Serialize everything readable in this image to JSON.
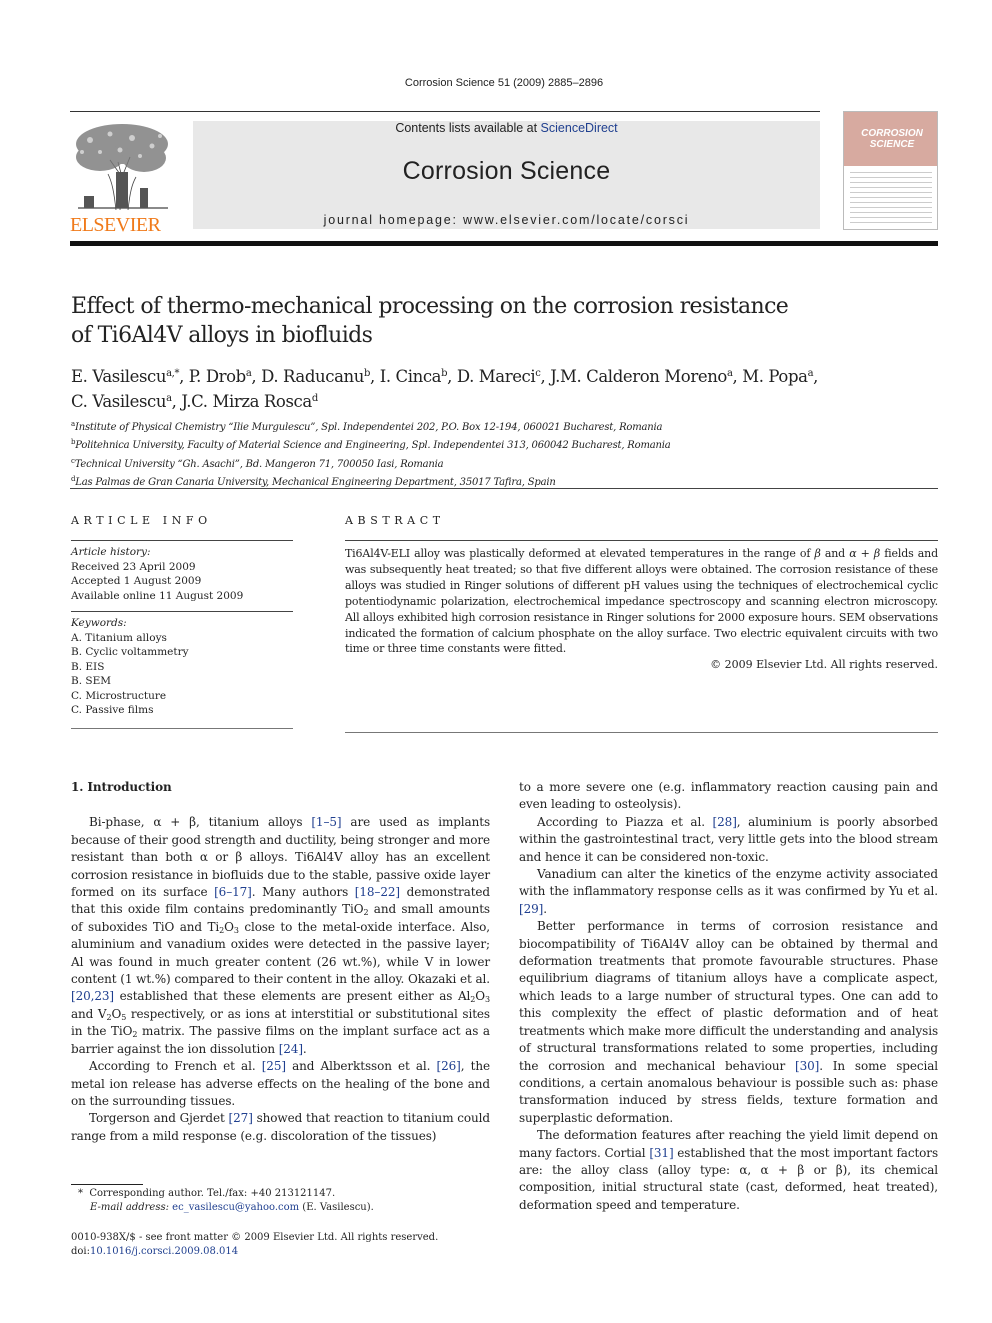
{
  "header": {
    "citation": "Corrosion Science 51 (2009) 2885–2896",
    "contents_prefix": "Contents lists available at ",
    "contents_link": "ScienceDirect",
    "journal_name": "Corrosion Science",
    "homepage": "journal homepage: www.elsevier.com/locate/corsci",
    "publisher_logo_text": "ELSEVIER",
    "cover_title_line1": "CORROSION",
    "cover_title_line2": "SCIENCE",
    "colors": {
      "publisher_orange": "#f07a1a",
      "link_blue": "#1f3f8f",
      "cover_pink": "#d7aaa0",
      "banner_gray": "#e8e8e8"
    }
  },
  "article": {
    "title_line1": "Effect of thermo-mechanical processing on the corrosion resistance",
    "title_line2": "of Ti6Al4V alloys in biofluids",
    "authors": [
      {
        "name": "E. Vasilescu",
        "aff": "a,*"
      },
      {
        "name": "P. Drob",
        "aff": "a"
      },
      {
        "name": "D. Raducanu",
        "aff": "b"
      },
      {
        "name": "I. Cinca",
        "aff": "b"
      },
      {
        "name": "D. Mareci",
        "aff": "c"
      },
      {
        "name": "J.M. Calderon Moreno",
        "aff": "a"
      },
      {
        "name": "M. Popa",
        "aff": "a"
      },
      {
        "name": "C. Vasilescu",
        "aff": "a"
      },
      {
        "name": "J.C. Mirza Rosca",
        "aff": "d"
      }
    ],
    "affiliations": [
      {
        "mark": "a",
        "text": "Institute of Physical Chemistry “Ilie Murgulescu”, Spl. Independentei 202, P.O. Box 12-194, 060021 Bucharest, Romania"
      },
      {
        "mark": "b",
        "text": "Politehnica University, Faculty of Material Science and Engineering, Spl. Independentei 313, 060042 Bucharest, Romania"
      },
      {
        "mark": "c",
        "text": "Technical University “Gh. Asachi”, Bd. Mangeron 71, 700050 Iasi, Romania"
      },
      {
        "mark": "d",
        "text": "Las Palmas de Gran Canaria University, Mechanical Engineering Department, 35017 Tafira, Spain"
      }
    ]
  },
  "article_info": {
    "heading": "ARTICLE INFO",
    "history_label": "Article history:",
    "received": "Received 23 April 2009",
    "accepted": "Accepted 1 August 2009",
    "online": "Available online 11 August 2009",
    "keywords_label": "Keywords:",
    "keywords": [
      "A. Titanium alloys",
      "B. Cyclic voltammetry",
      "B. EIS",
      "B. SEM",
      "C. Microstructure",
      "C. Passive films"
    ]
  },
  "abstract": {
    "heading": "ABSTRACT",
    "p1": "Ti6Al4V-ELI alloy was plastically deformed at elevated temperatures in the range of ",
    "beta": "β",
    "p2": " and ",
    "alpha_beta": "α + β",
    "p3": " fields and was subsequently heat treated; so that five different alloys were obtained. The corrosion resistance of these alloys was studied in Ringer solutions of different pH values using the techniques of electrochemical cyclic potentiodynamic polarization, electrochemical impedance spectroscopy and scanning electron microscopy. All alloys exhibited high corrosion resistance in Ringer solutions for 2000 exposure hours. SEM observations indicated the formation of calcium phosphate on the alloy surface. Two electric equivalent circuits with two time or three time constants were fitted.",
    "copyright": "© 2009 Elsevier Ltd. All rights reserved."
  },
  "body": {
    "section_heading": "1. Introduction",
    "left": {
      "p1_a": "Bi-phase, α + β, titanium alloys ",
      "ref_1_5": "[1–5]",
      "p1_b": " are used as implants because of their good strength and ductility, being stronger and more resistant than both α or β alloys. Ti6Al4V alloy has an excellent corrosion resistance in biofluids due to the stable, passive oxide layer formed on its surface ",
      "ref_6_17": "[6–17]",
      "p1_c": ". Many authors ",
      "ref_18_22": "[18–22]",
      "p1_d": " demonstrated that this oxide film contains predominantly TiO",
      "p1_e": " and small amounts of suboxides TiO and Ti",
      "p1_f": "O",
      "p1_g": " close to the metal-oxide interface. Also, aluminium and vanadium oxides were detected in the passive layer; Al was found in much greater content (26 wt.%), while V in lower content (1 wt.%) compared to their content in the alloy. Okazaki et al. ",
      "ref_20_23": "[20,23]",
      "p1_h": " established that these elements are present either as Al",
      "p1_i": "O",
      "p1_j": " and V",
      "p1_k": "O",
      "p1_l": " respectively, or as ions at interstitial or substitutional sites in the TiO",
      "p1_m": " matrix. The passive films on the implant surface act as a barrier against the ion dissolution ",
      "ref_24": "[24]",
      "p1_n": ".",
      "p2_a": "According to French et al. ",
      "ref_25": "[25]",
      "p2_b": " and Alberktsson et al. ",
      "ref_26": "[26]",
      "p2_c": ", the metal ion release has adverse effects on the healing of the bone and on the surrounding tissues.",
      "p3_a": "Torgerson and Gjerdet ",
      "ref_27": "[27]",
      "p3_b": " showed that reaction to titanium could range from a mild response (e.g. discoloration of the tissues)",
      "sub_2": "2",
      "sub_3": "3",
      "sub_5": "5"
    },
    "right": {
      "p0": "to a more severe one (e.g. inflammatory reaction causing pain and even leading to osteolysis).",
      "p1_a": "According to Piazza et al. ",
      "ref_28": "[28]",
      "p1_b": ", aluminium is poorly absorbed within the gastrointestinal tract, very little gets into the blood stream and hence it can be considered non-toxic.",
      "p2_a": "Vanadium can alter the kinetics of the enzyme activity associated with the inflammatory response cells as it was confirmed by Yu et al. ",
      "ref_29": "[29]",
      "p2_b": ".",
      "p3_a": "Better performance in terms of corrosion resistance and biocompatibility of Ti6Al4V alloy can be obtained by thermal and deformation treatments that promote favourable structures. Phase equilibrium diagrams of titanium alloys have a complicate aspect, which leads to a large number of structural types. One can add to this complexity the effect of plastic deformation and of heat treatments which make more difficult the understanding and analysis of structural transformations related to some properties, including the corrosion and mechanical behaviour ",
      "ref_30": "[30]",
      "p3_b": ". In some special conditions, a certain anomalous behaviour is possible such as: phase transformation induced by stress fields, texture formation and superplastic deformation.",
      "p4_a": "The deformation features after reaching the yield limit depend on many factors. Cortial ",
      "ref_31": "[31]",
      "p4_b": " established that the most important factors are: the alloy class (alloy type: α, α + β or β), its chemical composition, initial structural state (cast, deformed, heat treated), deformation speed and temperature."
    }
  },
  "footnote": {
    "mark": "*",
    "corresponding": "Corresponding author. Tel./fax: +40 213121147.",
    "email_label": "E-mail address:",
    "email": "ec_vasilescu@yahoo.com",
    "email_suffix": " (E. Vasilescu)."
  },
  "front_matter": {
    "issn_line": "0010-938X/$ - see front matter © 2009 Elsevier Ltd. All rights reserved.",
    "doi_prefix": "doi:",
    "doi": "10.1016/j.corsci.2009.08.014"
  }
}
